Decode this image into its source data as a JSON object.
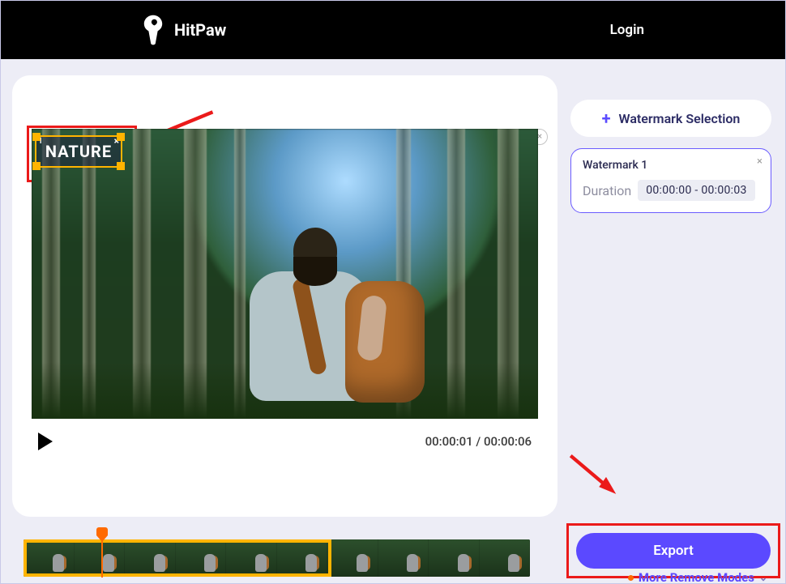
{
  "header": {
    "brand": "HitPaw",
    "login": "Login"
  },
  "preview": {
    "watermark_text": "NATURE",
    "watermark_index": "1",
    "close_glyph": "×"
  },
  "player": {
    "current": "00:00:01",
    "total": "00:00:06",
    "separator": " / "
  },
  "sidebar": {
    "add_label": "Watermark Selection",
    "plus": "+",
    "wm_title": "Watermark 1",
    "wm_close": "×",
    "duration_label": "Duration",
    "duration_value": "00:00:00 - 00:00:03"
  },
  "export": {
    "label": "Export",
    "more": "More Remove Modes",
    "chev": "⌄"
  },
  "close_preview": "×"
}
